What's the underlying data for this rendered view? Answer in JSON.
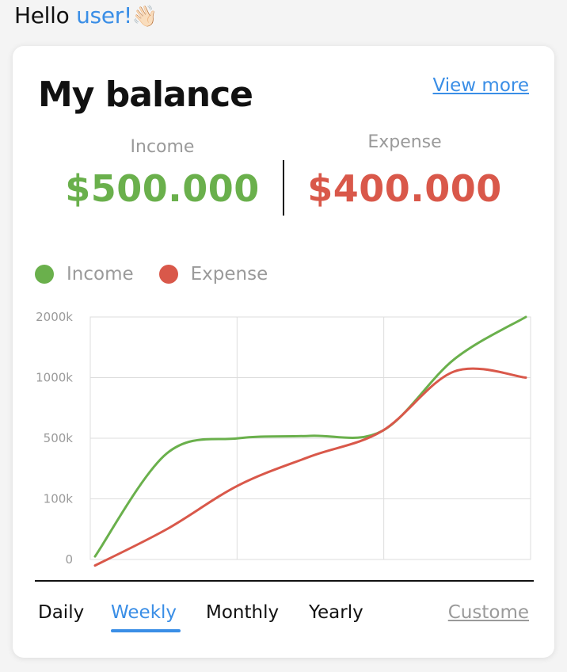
{
  "greeting": {
    "hello": "Hello",
    "user": "user!",
    "emoji": "👋🏻"
  },
  "card": {
    "title": "My balance",
    "view_more": "View more",
    "income": {
      "label": "Income",
      "value": "$500.000",
      "color": "#6ab04c"
    },
    "expense": {
      "label": "Expense",
      "value": "$400.000",
      "color": "#d9584a"
    }
  },
  "legend": [
    {
      "label": "Income",
      "color": "#6ab04c"
    },
    {
      "label": "Expense",
      "color": "#d9584a"
    }
  ],
  "tabs": [
    {
      "label": "Daily",
      "active": false
    },
    {
      "label": "Weekly",
      "active": true
    },
    {
      "label": "Monthly",
      "active": false
    },
    {
      "label": "Yearly",
      "active": false
    },
    {
      "label": "Custome",
      "active": false
    }
  ],
  "chart_data": {
    "type": "line",
    "title": "",
    "xlabel": "",
    "ylabel": "",
    "y_ticks": [
      "0",
      "100k",
      "500k",
      "1000k",
      "2000k"
    ],
    "grid": true,
    "x_gridlines": 3,
    "legend_position": "top-left",
    "series": [
      {
        "name": "Income",
        "color": "#6ab04c",
        "values": [
          5,
          400,
          500,
          520,
          560,
          1300,
          2000
        ]
      },
      {
        "name": "Expense",
        "color": "#d9584a",
        "values": [
          -10,
          50,
          190,
          380,
          560,
          1100,
          1000
        ]
      }
    ]
  }
}
